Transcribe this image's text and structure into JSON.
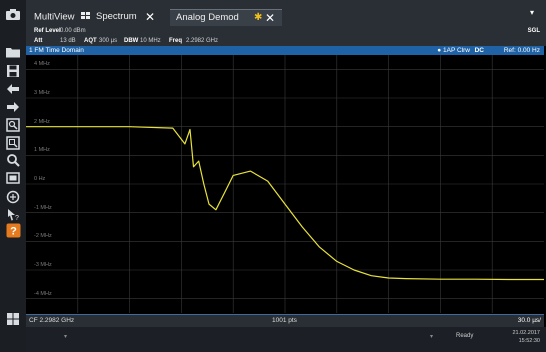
{
  "tabs": {
    "multiview": "MultiView",
    "spectrum": "Spectrum",
    "analog_demod": "Analog Demod",
    "close_glyph": "✕"
  },
  "topbar": {
    "menu_glyph": "▾",
    "sgl": "SGL"
  },
  "settings": {
    "ref_level_label": "Ref Level",
    "ref_level_value": "0.00 dBm",
    "att_label": "Att",
    "att_value": "13 dB",
    "aqt_label": "AQT",
    "aqt_value": "300 µs",
    "dbw_label": "DBW",
    "dbw_value": "10 MHz",
    "freq_label": "Freq",
    "freq_value": "2.2982 GHz"
  },
  "window": {
    "title": "1 FM Time Domain",
    "trace_info": "● 1AP Clrw",
    "dc": "DC",
    "ref": "Ref: 0.00 Hz"
  },
  "axis": {
    "y_labels": [
      "4 MHz",
      "3 MHz",
      "2 MHz",
      "1 MHz",
      "0 Hz",
      "-1 MHz",
      "-2 MHz",
      "-3 MHz",
      "-4 MHz"
    ]
  },
  "bottom": {
    "cf": "CF 2.2982 GHz",
    "pts": "1001 pts",
    "span": "30.0 µs/"
  },
  "status": {
    "ready": "Ready",
    "date": "21.02.2017",
    "time": "15:52:30"
  },
  "colors": {
    "trace": "#e8e23a",
    "title_bar": "#1f63a6",
    "grid": "#3a3a3a"
  },
  "chart_data": {
    "type": "line",
    "xlabel": "",
    "ylabel": "",
    "x_divisions": 10,
    "x_per_div": "30.0 µs",
    "points": 1001,
    "ylim": [
      -4.5,
      4.5
    ],
    "y_unit": "MHz",
    "series": [
      {
        "x": [
          0,
          30,
          60,
          85,
          92,
          95,
          97,
          100,
          103,
          106,
          110,
          115,
          120,
          130,
          140,
          150,
          160,
          170,
          180,
          190,
          200,
          210,
          220,
          240,
          260,
          280,
          300
        ],
        "y": [
          2.0,
          2.0,
          2.0,
          1.95,
          1.4,
          1.9,
          0.6,
          0.8,
          0.0,
          -0.7,
          -0.9,
          -0.3,
          0.3,
          0.45,
          0.1,
          -0.7,
          -1.5,
          -2.2,
          -2.7,
          -3.0,
          -3.2,
          -3.28,
          -3.3,
          -3.32,
          -3.32,
          -3.33,
          -3.33
        ]
      }
    ]
  }
}
